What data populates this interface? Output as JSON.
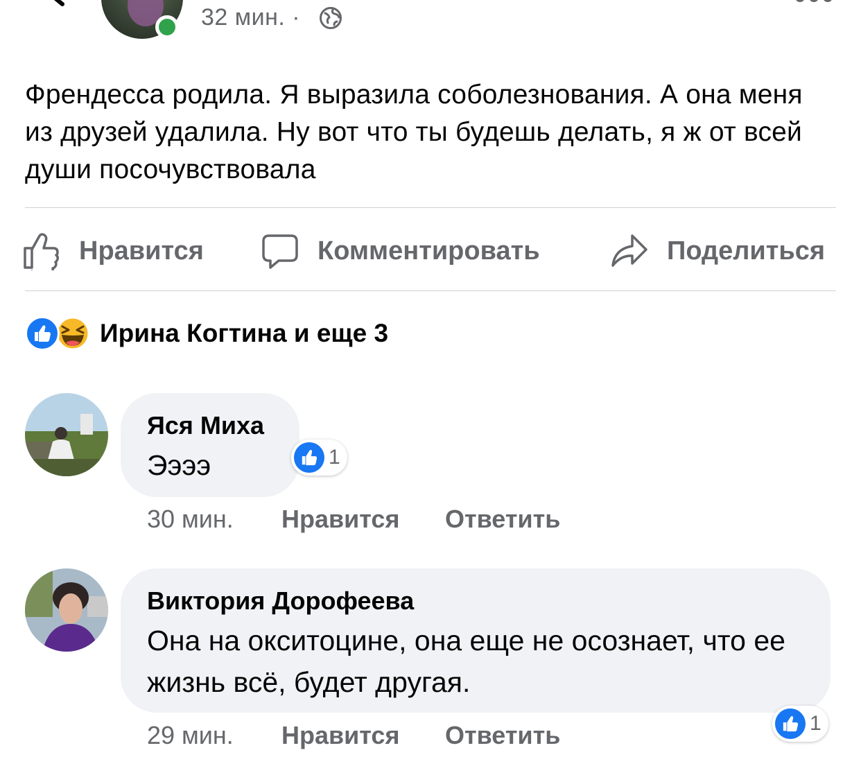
{
  "post": {
    "time": "32 мин. ·",
    "text": "Френдесса родила. Я выразила соболезнования. А она меня из друзей удалила. Ну вот что ты будешь делать, я ж от всей души посочувствовала"
  },
  "actions": {
    "like": "Нравится",
    "comment": "Комментировать",
    "share": "Поделиться"
  },
  "reactions": {
    "summary": "Ирина Когтина и еще 3",
    "icons": [
      "like-reaction-icon",
      "haha-reaction-icon"
    ]
  },
  "comments": [
    {
      "author": "Яся Миха",
      "text": "Ээээ",
      "time": "30 мин.",
      "like_label": "Нравится",
      "reply_label": "Ответить",
      "like_count": "1"
    },
    {
      "author": "Виктория Дорофеева",
      "text": "Она на окситоцине, она еще не осознает, что ее жизнь всё, будет другая.",
      "time": "29 мин.",
      "like_label": "Нравится",
      "reply_label": "Ответить",
      "like_count": "1"
    }
  ],
  "colors": {
    "brand_blue": "#1877f2",
    "online_green": "#31a24c",
    "secondary_text": "#65676b",
    "bubble_bg": "#f0f2f5"
  }
}
